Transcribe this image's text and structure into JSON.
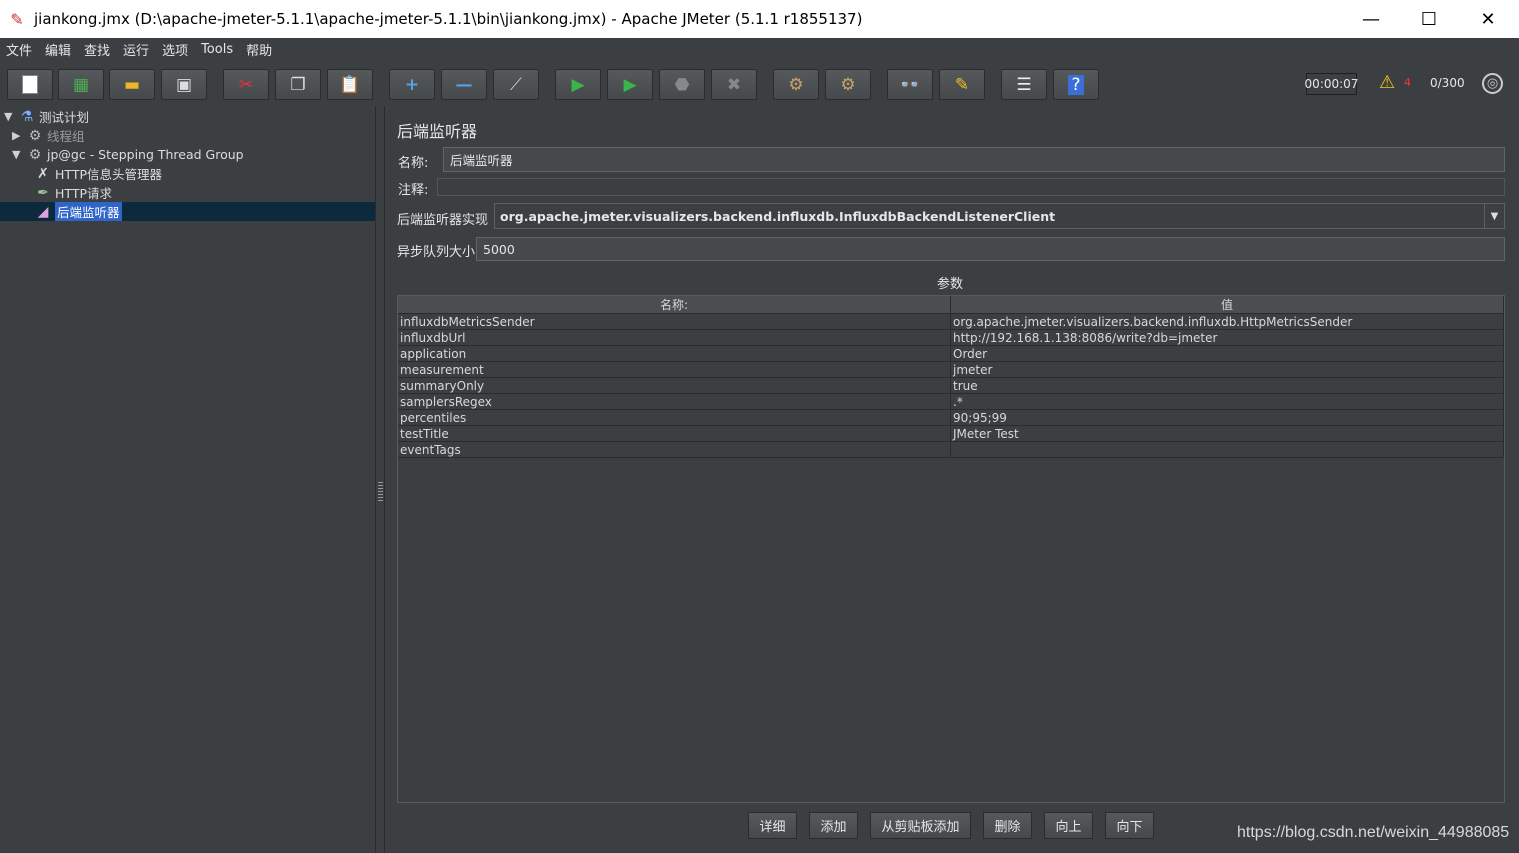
{
  "window": {
    "title": "jiankong.jmx (D:\\apache-jmeter-5.1.1\\apache-jmeter-5.1.1\\bin\\jiankong.jmx) - Apache JMeter (5.1.1 r1855137)",
    "minimize": "—",
    "maximize": "☐",
    "close": "✕"
  },
  "menu": [
    "文件",
    "编辑",
    "查找",
    "运行",
    "选项",
    "Tools",
    "帮助"
  ],
  "toolbar": {
    "timer": "00:00:07",
    "warning_count": "4",
    "threads": "0/300",
    "icons": [
      "new-icon",
      "templates-icon",
      "open-icon",
      "save-icon",
      "cut-icon",
      "copy-icon",
      "paste-icon",
      "expand-icon",
      "collapse-icon",
      "toggle-icon",
      "start-icon",
      "start-no-timers-icon",
      "stop-icon",
      "shutdown-icon",
      "clear-icon",
      "clear-all-icon",
      "search-icon",
      "reset-search-icon",
      "function-helper-icon",
      "help-icon"
    ]
  },
  "tree": {
    "items": [
      {
        "label": "测试计划",
        "icon": "test-plan-icon"
      },
      {
        "label": "线程组",
        "icon": "thread-group-icon"
      },
      {
        "label": "jp@gc - Stepping Thread Group",
        "icon": "stepping-thread-group-icon"
      },
      {
        "label": "HTTP信息头管理器",
        "icon": "header-manager-icon"
      },
      {
        "label": "HTTP请求",
        "icon": "http-request-icon"
      },
      {
        "label": "后端监听器",
        "icon": "backend-listener-icon"
      }
    ]
  },
  "panel": {
    "title": "后端监听器",
    "name_label": "名称:",
    "name_value": "后端监听器",
    "comment_label": "注释:",
    "comment_value": "",
    "impl_label": "后端监听器实现",
    "impl_value": "org.apache.jmeter.visualizers.backend.influxdb.InfluxdbBackendListenerClient",
    "queue_label": "异步队列大小",
    "queue_value": "5000",
    "params_title": "参数"
  },
  "table": {
    "headers": [
      "名称:",
      "值"
    ],
    "rows": [
      [
        "influxdbMetricsSender",
        "org.apache.jmeter.visualizers.backend.influxdb.HttpMetricsSender"
      ],
      [
        "influxdbUrl",
        "http://192.168.1.138:8086/write?db=jmeter"
      ],
      [
        "application",
        "Order"
      ],
      [
        "measurement",
        "jmeter"
      ],
      [
        "summaryOnly",
        "true"
      ],
      [
        "samplersRegex",
        ".*"
      ],
      [
        "percentiles",
        "90;95;99"
      ],
      [
        "testTitle",
        "JMeter Test"
      ],
      [
        "eventTags",
        ""
      ]
    ]
  },
  "buttons": {
    "detail": "详细",
    "add": "添加",
    "add_from_clipboard": "从剪贴板添加",
    "delete": "删除",
    "up": "向上",
    "down": "向下"
  },
  "watermark": "https://blog.csdn.net/weixin_44988085"
}
